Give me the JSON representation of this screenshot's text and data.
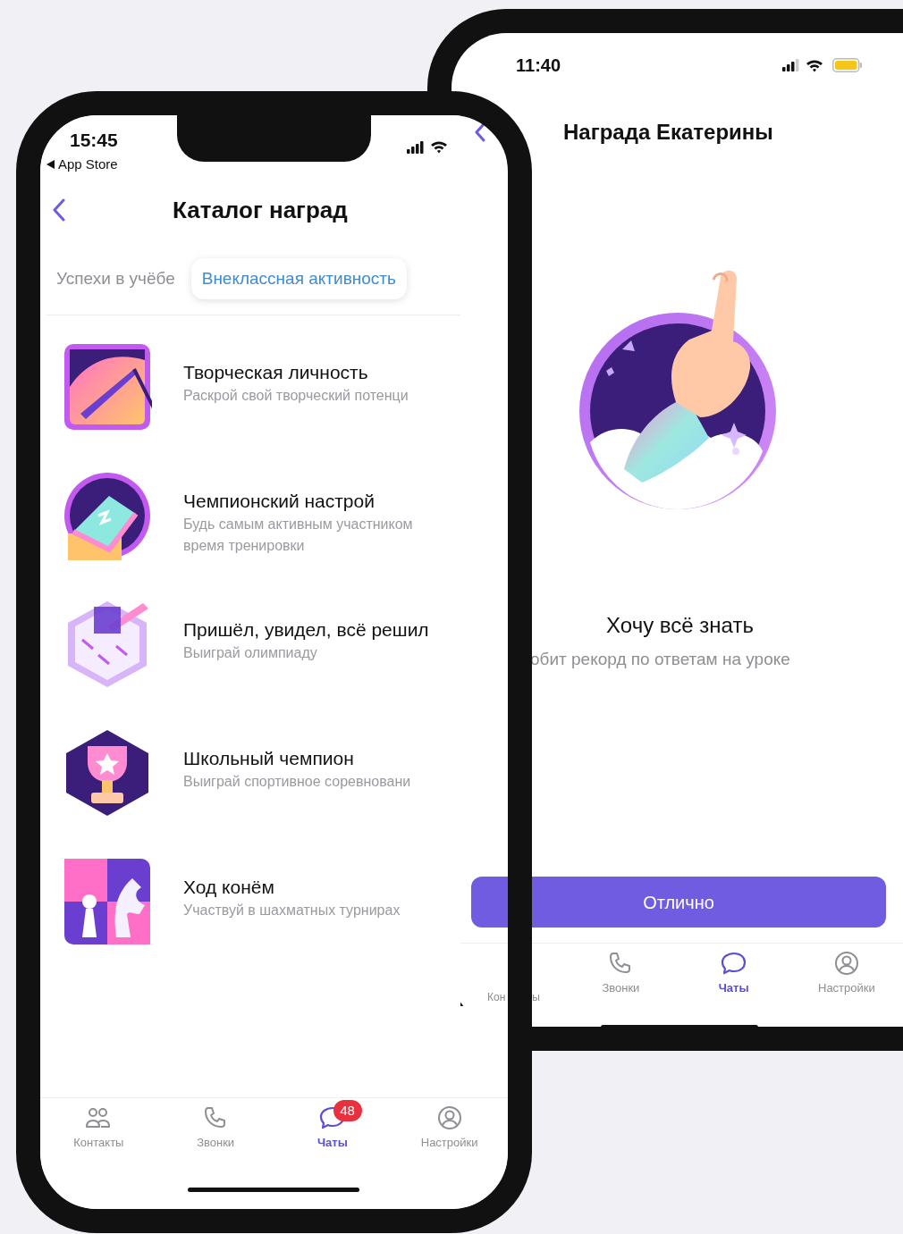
{
  "back_phone": {
    "status_time": "11:40",
    "title": "Награда Екатерины",
    "award_name": "Хочу всё знать",
    "award_description": "обит рекорд по ответам на уроке",
    "button": "Отлично",
    "tab_bar": [
      {
        "label": "Кон",
        "label_tail": "ы",
        "selected": false
      },
      {
        "kind": "calls",
        "label": "Звонки",
        "selected": false
      },
      {
        "kind": "chats",
        "label": "Чаты",
        "selected": true
      },
      {
        "kind": "settings",
        "label": "Настройки",
        "selected": false
      }
    ]
  },
  "front_phone": {
    "status_time": "15:45",
    "back_link": "App Store",
    "title": "Каталог наград",
    "tabs": [
      {
        "label": "Успехи в учёбе",
        "selected": false
      },
      {
        "label": "Внеклассная активность",
        "selected": true
      }
    ],
    "awards": [
      {
        "title": "Творческая личность",
        "subtitle_lines": [
          "Раскрой свой творческий потенци"
        ]
      },
      {
        "title": "Чемпионский настрой",
        "subtitle_lines": [
          "Будь самым активным участником",
          "время тренировки"
        ]
      },
      {
        "title": "Пришёл, увидел, всё решил",
        "subtitle_lines": [
          "Выиграй олимпиаду"
        ]
      },
      {
        "title": "Школьный чемпион",
        "subtitle_lines": [
          "Выиграй спортивное соревновани"
        ]
      },
      {
        "title": "Ход конём",
        "subtitle_lines": [
          "Участвуй в шахматных турнирах"
        ]
      }
    ],
    "tab_bar": [
      {
        "kind": "contacts",
        "label": "Контакты",
        "selected": false
      },
      {
        "kind": "calls",
        "label": "Звонки",
        "selected": false
      },
      {
        "kind": "chats",
        "label": "Чаты",
        "selected": true,
        "badge": "48"
      },
      {
        "kind": "settings",
        "label": "Настройки",
        "selected": false
      }
    ]
  }
}
